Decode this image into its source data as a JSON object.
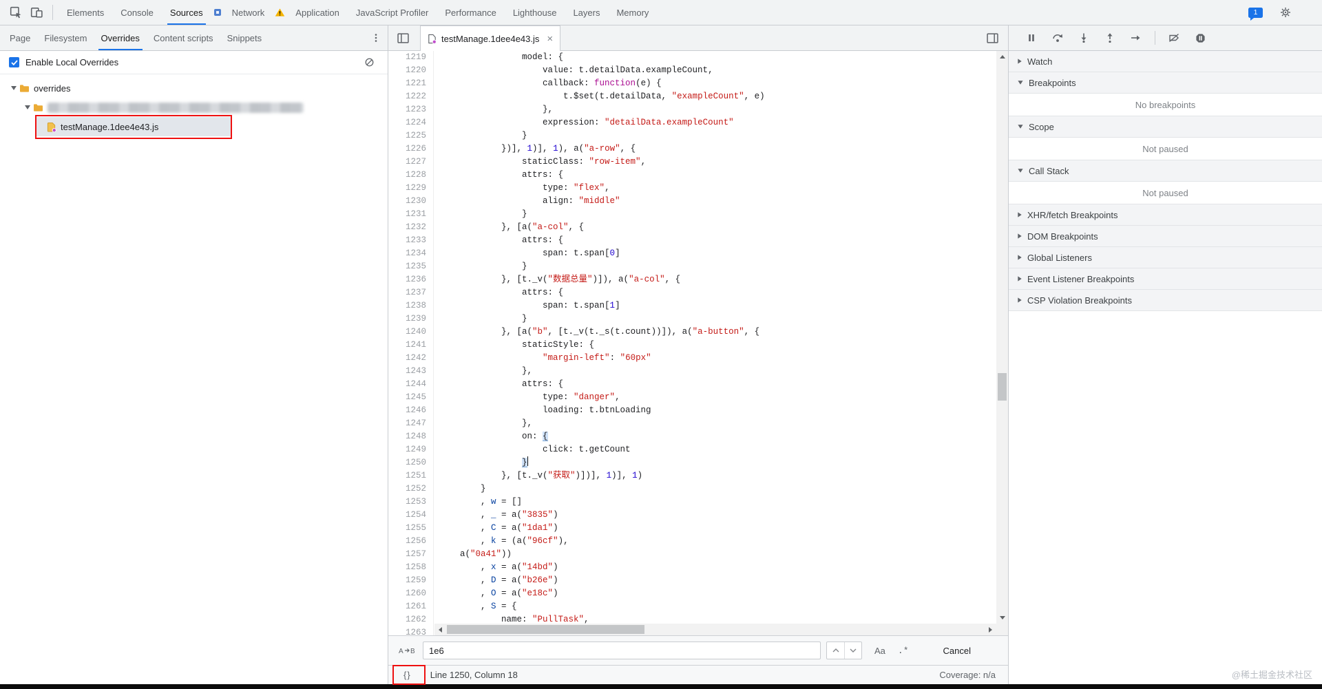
{
  "colors": {
    "accent": "#1a73e8",
    "string": "#c41a16",
    "number": "#1c00cf",
    "keyword": "#aa0d91",
    "definition": "#0842a0",
    "annotation": "#ee1010",
    "warning": "#f5b400",
    "folder": "#ebab35",
    "selection": "#e2e6eb"
  },
  "top_toolbar": {
    "left_icons": [
      "inspect-icon",
      "device-toolbar-icon"
    ],
    "tabs": [
      {
        "label": "Elements"
      },
      {
        "label": "Console"
      },
      {
        "label": "Sources",
        "active": true
      },
      {
        "icon": "extension-panel-icon"
      },
      {
        "label": "Network"
      },
      {
        "icon": "warning-icon"
      },
      {
        "label": "Application"
      },
      {
        "label": "JavaScript Profiler"
      },
      {
        "label": "Performance"
      },
      {
        "label": "Lighthouse"
      },
      {
        "label": "Layers"
      },
      {
        "label": "Memory"
      }
    ],
    "messages_count": "1",
    "right_icons": [
      "console-messages-badge",
      "settings-gear-icon"
    ]
  },
  "navigator": {
    "tabs": [
      {
        "label": "Page"
      },
      {
        "label": "Filesystem"
      },
      {
        "label": "Overrides",
        "active": true
      },
      {
        "label": "Content scripts"
      },
      {
        "label": "Snippets"
      }
    ],
    "more_icon": "more-vertical-icon",
    "enable_overrides": {
      "label": "Enable Local Overrides",
      "checked": true,
      "clear_icon": "block-icon"
    },
    "tree": [
      {
        "depth": 0,
        "expanded": true,
        "icon": "folder-icon",
        "label": "overrides"
      },
      {
        "depth": 1,
        "expanded": true,
        "icon": "folder-icon",
        "redacted": true
      },
      {
        "depth": 2,
        "icon": "js-file-icon",
        "label": "testManage.1dee4e43.js",
        "selected": true
      }
    ]
  },
  "editor": {
    "tab": {
      "icon": "file-override-icon",
      "label": "testManage.1dee4e43.js"
    },
    "code_lines": [
      {
        "n": 1219,
        "tok": [
          [
            "                model: {",
            "p"
          ]
        ]
      },
      {
        "n": 1220,
        "tok": [
          [
            "                    value: t.detailData.exampleCount,",
            "p"
          ]
        ]
      },
      {
        "n": 1221,
        "tok": [
          [
            "                    callback: ",
            "p"
          ],
          [
            "function",
            "k"
          ],
          [
            "(e) {",
            "p"
          ]
        ]
      },
      {
        "n": 1222,
        "tok": [
          [
            "                        t.$set(t.detailData, ",
            "p"
          ],
          [
            "\"exampleCount\"",
            "s"
          ],
          [
            ", e)",
            "p"
          ]
        ]
      },
      {
        "n": 1223,
        "tok": [
          [
            "                    },",
            "p"
          ]
        ]
      },
      {
        "n": 1224,
        "tok": [
          [
            "                    expression: ",
            "p"
          ],
          [
            "\"detailData.exampleCount\"",
            "s"
          ]
        ]
      },
      {
        "n": 1225,
        "tok": [
          [
            "                }",
            "p"
          ]
        ]
      },
      {
        "n": 1226,
        "tok": [
          [
            "            })], ",
            "p"
          ],
          [
            "1",
            "n"
          ],
          [
            ")], ",
            "p"
          ],
          [
            "1",
            "n"
          ],
          [
            "), a(",
            "p"
          ],
          [
            "\"a-row\"",
            "s"
          ],
          [
            ", {",
            "p"
          ]
        ]
      },
      {
        "n": 1227,
        "tok": [
          [
            "                staticClass: ",
            "p"
          ],
          [
            "\"row-item\"",
            "s"
          ],
          [
            ",",
            "p"
          ]
        ]
      },
      {
        "n": 1228,
        "tok": [
          [
            "                attrs: {",
            "p"
          ]
        ]
      },
      {
        "n": 1229,
        "tok": [
          [
            "                    type: ",
            "p"
          ],
          [
            "\"flex\"",
            "s"
          ],
          [
            ",",
            "p"
          ]
        ]
      },
      {
        "n": 1230,
        "tok": [
          [
            "                    align: ",
            "p"
          ],
          [
            "\"middle\"",
            "s"
          ]
        ]
      },
      {
        "n": 1231,
        "tok": [
          [
            "                }",
            "p"
          ]
        ]
      },
      {
        "n": 1232,
        "tok": [
          [
            "            }, [a(",
            "p"
          ],
          [
            "\"a-col\"",
            "s"
          ],
          [
            ", {",
            "p"
          ]
        ]
      },
      {
        "n": 1233,
        "tok": [
          [
            "                attrs: {",
            "p"
          ]
        ]
      },
      {
        "n": 1234,
        "tok": [
          [
            "                    span: t.span[",
            "p"
          ],
          [
            "0",
            "n"
          ],
          [
            "]",
            "p"
          ]
        ]
      },
      {
        "n": 1235,
        "tok": [
          [
            "                }",
            "p"
          ]
        ]
      },
      {
        "n": 1236,
        "tok": [
          [
            "            }, [t._v(",
            "p"
          ],
          [
            "\"数据总量\"",
            "s"
          ],
          [
            ")]), a(",
            "p"
          ],
          [
            "\"a-col\"",
            "s"
          ],
          [
            ", {",
            "p"
          ]
        ]
      },
      {
        "n": 1237,
        "tok": [
          [
            "                attrs: {",
            "p"
          ]
        ]
      },
      {
        "n": 1238,
        "tok": [
          [
            "                    span: t.span[",
            "p"
          ],
          [
            "1",
            "n"
          ],
          [
            "]",
            "p"
          ]
        ]
      },
      {
        "n": 1239,
        "tok": [
          [
            "                }",
            "p"
          ]
        ]
      },
      {
        "n": 1240,
        "tok": [
          [
            "            }, [a(",
            "p"
          ],
          [
            "\"b\"",
            "s"
          ],
          [
            ", [t._v(t._s(t.count))]), a(",
            "p"
          ],
          [
            "\"a-button\"",
            "s"
          ],
          [
            ", {",
            "p"
          ]
        ]
      },
      {
        "n": 1241,
        "tok": [
          [
            "                staticStyle: {",
            "p"
          ]
        ]
      },
      {
        "n": 1242,
        "tok": [
          [
            "                    ",
            "p"
          ],
          [
            "\"margin-left\"",
            "s"
          ],
          [
            ": ",
            "p"
          ],
          [
            "\"60px\"",
            "s"
          ]
        ]
      },
      {
        "n": 1243,
        "tok": [
          [
            "                },",
            "p"
          ]
        ]
      },
      {
        "n": 1244,
        "tok": [
          [
            "                attrs: {",
            "p"
          ]
        ]
      },
      {
        "n": 1245,
        "tok": [
          [
            "                    type: ",
            "p"
          ],
          [
            "\"danger\"",
            "s"
          ],
          [
            ",",
            "p"
          ]
        ]
      },
      {
        "n": 1246,
        "tok": [
          [
            "                    loading: t.btnLoading",
            "p"
          ]
        ]
      },
      {
        "n": 1247,
        "tok": [
          [
            "                },",
            "p"
          ]
        ]
      },
      {
        "n": 1248,
        "tok": [
          [
            "                on: ",
            "p"
          ],
          [
            "{",
            "b"
          ]
        ]
      },
      {
        "n": 1249,
        "tok": [
          [
            "                    click: t.getCount",
            "p"
          ]
        ]
      },
      {
        "n": 1250,
        "tok": [
          [
            "                ",
            "p"
          ],
          [
            "}",
            "b"
          ],
          [
            "",
            "c"
          ]
        ]
      },
      {
        "n": 1251,
        "tok": [
          [
            "            }, [t._v(",
            "p"
          ],
          [
            "\"获取\"",
            "s"
          ],
          [
            ")])], ",
            "p"
          ],
          [
            "1",
            "n"
          ],
          [
            ")], ",
            "p"
          ],
          [
            "1",
            "n"
          ],
          [
            ")",
            "p"
          ]
        ]
      },
      {
        "n": 1252,
        "tok": [
          [
            "        }",
            "p"
          ]
        ]
      },
      {
        "n": 1253,
        "tok": [
          [
            "        , ",
            "p"
          ],
          [
            "w",
            "d"
          ],
          [
            " = []",
            "p"
          ]
        ]
      },
      {
        "n": 1254,
        "tok": [
          [
            "        , ",
            "p"
          ],
          [
            "_",
            "d"
          ],
          [
            " = a(",
            "p"
          ],
          [
            "\"3835\"",
            "s"
          ],
          [
            ")",
            "p"
          ]
        ]
      },
      {
        "n": 1255,
        "tok": [
          [
            "        , ",
            "p"
          ],
          [
            "C",
            "d"
          ],
          [
            " = a(",
            "p"
          ],
          [
            "\"1da1\"",
            "s"
          ],
          [
            ")",
            "p"
          ]
        ]
      },
      {
        "n": 1256,
        "tok": [
          [
            "        , ",
            "p"
          ],
          [
            "k",
            "d"
          ],
          [
            " = (a(",
            "p"
          ],
          [
            "\"96cf\"",
            "s"
          ],
          [
            "),",
            "p"
          ]
        ]
      },
      {
        "n": 1257,
        "tok": [
          [
            "    a(",
            "p"
          ],
          [
            "\"0a41\"",
            "s"
          ],
          [
            "))",
            "p"
          ]
        ]
      },
      {
        "n": 1258,
        "tok": [
          [
            "        , ",
            "p"
          ],
          [
            "x",
            "d"
          ],
          [
            " = a(",
            "p"
          ],
          [
            "\"14bd\"",
            "s"
          ],
          [
            ")",
            "p"
          ]
        ]
      },
      {
        "n": 1259,
        "tok": [
          [
            "        , ",
            "p"
          ],
          [
            "D",
            "d"
          ],
          [
            " = a(",
            "p"
          ],
          [
            "\"b26e\"",
            "s"
          ],
          [
            ")",
            "p"
          ]
        ]
      },
      {
        "n": 1260,
        "tok": [
          [
            "        , ",
            "p"
          ],
          [
            "O",
            "d"
          ],
          [
            " = a(",
            "p"
          ],
          [
            "\"e18c\"",
            "s"
          ],
          [
            ")",
            "p"
          ]
        ]
      },
      {
        "n": 1261,
        "tok": [
          [
            "        , ",
            "p"
          ],
          [
            "S",
            "d"
          ],
          [
            " = {",
            "p"
          ]
        ]
      },
      {
        "n": 1262,
        "tok": [
          [
            "            name: ",
            "p"
          ],
          [
            "\"PullTask\"",
            "s"
          ],
          [
            ",",
            "p"
          ]
        ]
      },
      {
        "n": 1263,
        "tok": []
      }
    ]
  },
  "search_bar": {
    "replace_icon": "replace-icon",
    "query": "1e6",
    "match_case": "Aa",
    "regex": ".*",
    "cancel": "Cancel"
  },
  "status_bar": {
    "pretty_print": "{}",
    "line_col": "Line 1250, Column 18",
    "coverage": "Coverage: n/a"
  },
  "debugger_sidebar": {
    "toolbar_icons": [
      {
        "name": "pause-icon"
      },
      {
        "name": "step-over-icon"
      },
      {
        "name": "step-into-icon"
      },
      {
        "name": "step-out-icon"
      },
      {
        "name": "step-icon"
      },
      {
        "name": "separator"
      },
      {
        "name": "deactivate-breakpoints-icon"
      },
      {
        "name": "pause-on-exceptions-icon"
      }
    ],
    "sections": [
      {
        "label": "Watch",
        "expanded": false
      },
      {
        "label": "Breakpoints",
        "expanded": true,
        "content": "No breakpoints"
      },
      {
        "label": "Scope",
        "expanded": true,
        "content": "Not paused"
      },
      {
        "label": "Call Stack",
        "expanded": true,
        "content": "Not paused"
      },
      {
        "label": "XHR/fetch Breakpoints",
        "expanded": false
      },
      {
        "label": "DOM Breakpoints",
        "expanded": false
      },
      {
        "label": "Global Listeners",
        "expanded": false
      },
      {
        "label": "Event Listener Breakpoints",
        "expanded": false
      },
      {
        "label": "CSP Violation Breakpoints",
        "expanded": false
      }
    ]
  },
  "watermark": "@稀土掘金技术社区"
}
